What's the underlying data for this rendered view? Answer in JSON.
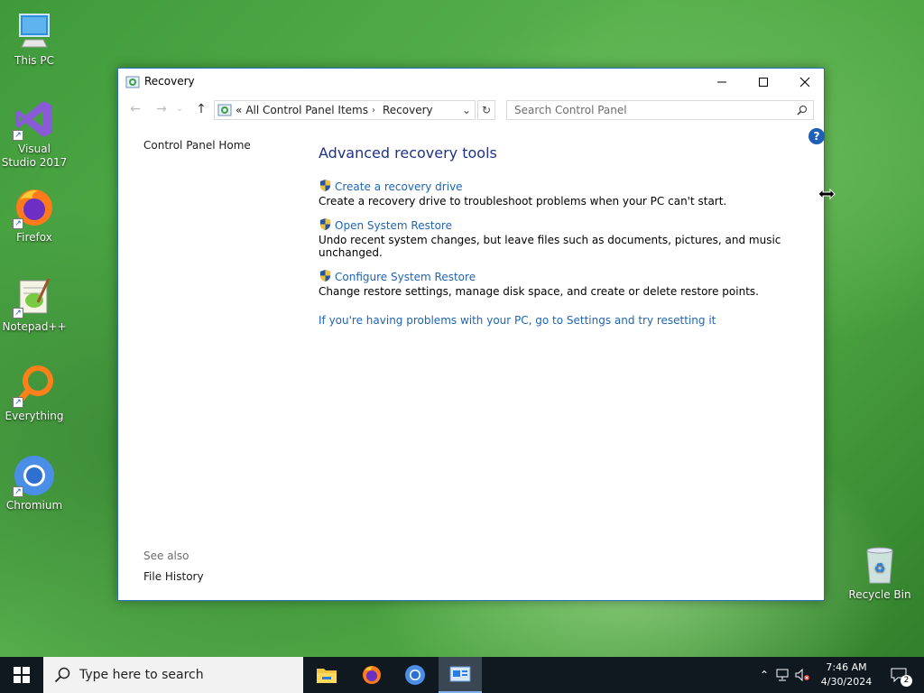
{
  "desktop": {
    "icons": [
      {
        "label": "This PC"
      },
      {
        "label": "Visual Studio 2017"
      },
      {
        "label": "Firefox"
      },
      {
        "label": "Notepad++"
      },
      {
        "label": "Everything"
      },
      {
        "label": "Chromium"
      },
      {
        "label": "Recycle Bin"
      }
    ]
  },
  "window": {
    "title": "Recovery",
    "breadcrumb": {
      "overflow": "«",
      "parent": "All Control Panel Items",
      "current": "Recovery"
    },
    "search_placeholder": "Search Control Panel",
    "help_label": "?",
    "left_pane": {
      "home_link": "Control Panel Home",
      "see_also_label": "See also",
      "see_also_links": [
        "File History"
      ]
    },
    "main": {
      "heading": "Advanced recovery tools",
      "tools": [
        {
          "title": "Create a recovery drive",
          "description": "Create a recovery drive to troubleshoot problems when your PC can't start."
        },
        {
          "title": "Open System Restore",
          "description": "Undo recent system changes, but leave files such as documents, pictures, and music unchanged."
        },
        {
          "title": "Configure System Restore",
          "description": "Change restore settings, manage disk space, and create or delete restore points."
        }
      ],
      "reset_link": "If you're having problems with your PC, go to Settings and try resetting it"
    }
  },
  "taskbar": {
    "search_placeholder": "Type here to search",
    "apps": [
      "file-explorer",
      "firefox",
      "chromium",
      "control-panel"
    ],
    "clock_time": "7:46 AM",
    "clock_date": "4/30/2024",
    "notification_count": "2"
  }
}
